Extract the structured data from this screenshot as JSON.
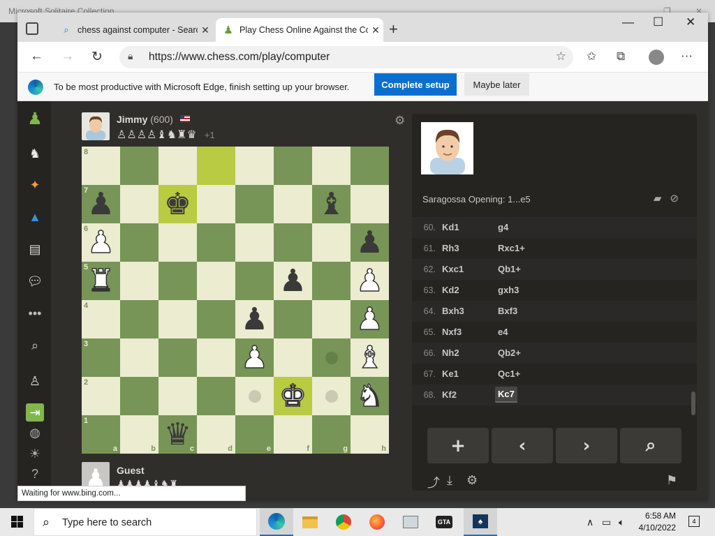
{
  "background_app": {
    "title": "Microsoft Solitaire Collection"
  },
  "browser": {
    "tabs": [
      {
        "label": "chess against computer - Search",
        "active": false
      },
      {
        "label": "Play Chess Online Against the Co",
        "active": true
      }
    ],
    "url": "https://www.chess.com/play/computer",
    "infobar": {
      "message": "To be most productive with Microsoft Edge, finish setting up your browser.",
      "primary_label": "Complete setup",
      "secondary_label": "Maybe later"
    },
    "status_text": "Waiting for www.bing.com..."
  },
  "game": {
    "top_player": {
      "name": "Jimmy",
      "rating": "(600)",
      "country": "US",
      "captured": "♙♙♙♙♝♞♜♛",
      "advantage": "+1"
    },
    "bottom_player": {
      "name": "Guest",
      "captured": "♟♟♟♟♝♞♜"
    },
    "board": {
      "ranks": [
        [
          "",
          "",
          "",
          "",
          "",
          "",
          "",
          ""
        ],
        [
          "bp",
          "",
          "bk",
          "",
          "",
          "",
          "bb",
          ""
        ],
        [
          "wp",
          "",
          "",
          "",
          "",
          "",
          "",
          "bp"
        ],
        [
          "wr",
          "",
          "",
          "",
          "",
          "bp",
          "",
          "wp"
        ],
        [
          "",
          "",
          "",
          "",
          "bp",
          "",
          "",
          "wp"
        ],
        [
          "",
          "",
          "",
          "",
          "wp",
          "",
          "",
          "wb"
        ],
        [
          "",
          "",
          "",
          "",
          "",
          "wk",
          "",
          "wn"
        ],
        [
          "",
          "",
          "bq",
          "",
          "",
          "",
          "",
          ""
        ]
      ],
      "highlights": [
        "d8",
        "c7",
        "f2"
      ],
      "move_dots": [
        "g3",
        "e2",
        "g2"
      ],
      "rank_labels": [
        "8",
        "7",
        "6",
        "5",
        "4",
        "3",
        "2",
        "1"
      ],
      "file_labels": [
        "a",
        "b",
        "c",
        "d",
        "e",
        "f",
        "g",
        "h"
      ]
    },
    "opening": "Saragossa Opening: 1...e5",
    "moves": [
      {
        "no": "60.",
        "white": "Kd1",
        "black": "g4"
      },
      {
        "no": "61.",
        "white": "Rh3",
        "black": "Rxc1+"
      },
      {
        "no": "62.",
        "white": "Kxc1",
        "black": "Qb1+"
      },
      {
        "no": "63.",
        "white": "Kd2",
        "black": "gxh3"
      },
      {
        "no": "64.",
        "white": "Bxh3",
        "black": "Bxf3"
      },
      {
        "no": "65.",
        "white": "Nxf3",
        "black": "e4"
      },
      {
        "no": "66.",
        "white": "Nh2",
        "black": "Qb2+"
      },
      {
        "no": "67.",
        "white": "Ke1",
        "black": "Qc1+"
      },
      {
        "no": "68.",
        "white": "Kf2",
        "black": "Kc7"
      }
    ],
    "current_move": "Kc7",
    "controls": [
      {
        "name": "new-game-button",
        "glyph": "+"
      },
      {
        "name": "previous-move-button",
        "glyph": "‹"
      },
      {
        "name": "next-move-button",
        "glyph": "›"
      },
      {
        "name": "analysis-button",
        "glyph": "⌕"
      }
    ]
  },
  "taskbar": {
    "search_placeholder": "Type here to search",
    "time": "6:58 AM",
    "date": "4/10/2022",
    "notification_count": "4"
  },
  "colors": {
    "board_light": "#ebecd0",
    "board_dark": "#779556",
    "highlight": "#b9ca43",
    "edge_blue": "#0a6ed1",
    "panel_bg": "#262421"
  }
}
